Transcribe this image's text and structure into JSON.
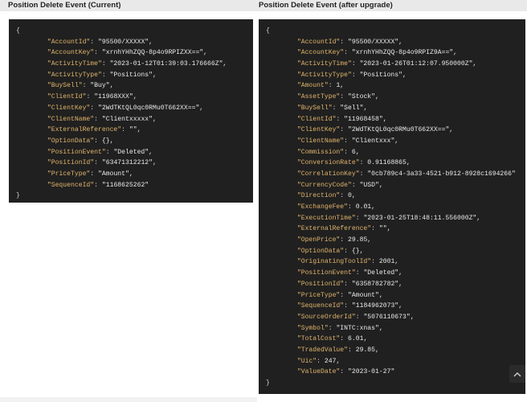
{
  "left": {
    "title": "Position Delete Event (Current)",
    "open_brace": "{",
    "close_brace": "}",
    "fields": [
      {
        "key": "\"AccountId\"",
        "value": "\"95500/XXXXX\","
      },
      {
        "key": "\"AccountKey\"",
        "value": "\"xrnhYHhZQQ-8p4o9RPIZXX==\","
      },
      {
        "key": "\"ActivityTime\"",
        "value": "\"2023-01-12T01:39:03.176666Z\","
      },
      {
        "key": "\"ActivityType\"",
        "value": "\"Positions\","
      },
      {
        "key": "\"BuySell\"",
        "value": "\"Buy\","
      },
      {
        "key": "\"ClientId\"",
        "value": "\"11968XXX\","
      },
      {
        "key": "\"ClientKey\"",
        "value": "\"2WdTKtQL0qc0RMu0T662XX==\","
      },
      {
        "key": "\"ClientName\"",
        "value": "\"Clientxxxxx\","
      },
      {
        "key": "\"ExternalReference\"",
        "value": "\"\","
      },
      {
        "key": "\"OptionData\"",
        "value": "{},"
      },
      {
        "key": "\"PositionEvent\"",
        "value": "\"Deleted\","
      },
      {
        "key": "\"PositionId\"",
        "value": "\"63471312212\","
      },
      {
        "key": "\"PriceType\"",
        "value": "\"Amount\","
      },
      {
        "key": "\"SequenceId\"",
        "value": "\"1168625262\""
      }
    ]
  },
  "right": {
    "title": "Position Delete Event (after upgrade)",
    "open_brace": "{",
    "close_brace": "}",
    "fields": [
      {
        "key": "\"AccountId\"",
        "value": "\"95500/XXXXX\","
      },
      {
        "key": "\"AccountKey\"",
        "value": "\"xrnhYHhZQQ-8p4o9RPIZ9A==\","
      },
      {
        "key": "\"ActivityTime\"",
        "value": "\"2023-01-26T01:12:07.950000Z\","
      },
      {
        "key": "\"ActivityType\"",
        "value": "\"Positions\","
      },
      {
        "key": "\"Amount\"",
        "value": "1,"
      },
      {
        "key": "\"AssetType\"",
        "value": "\"Stock\","
      },
      {
        "key": "\"BuySell\"",
        "value": "\"Sell\","
      },
      {
        "key": "\"ClientId\"",
        "value": "\"11968458\","
      },
      {
        "key": "\"ClientKey\"",
        "value": "\"2WdTKtQL0qc0RMu0T662XX==\","
      },
      {
        "key": "\"ClientName\"",
        "value": "\"Clientxxx\","
      },
      {
        "key": "\"Commission\"",
        "value": "6,"
      },
      {
        "key": "\"ConversionRate\"",
        "value": "0.91168865,"
      },
      {
        "key": "\"CorrelationKey\"",
        "value": "\"0cb789c4-3a33-4521-b912-8928c1694266\""
      },
      {
        "key": "\"CurrencyCode\"",
        "value": "\"USD\","
      },
      {
        "key": "\"Direction\"",
        "value": "0,"
      },
      {
        "key": "\"ExchangeFee\"",
        "value": "0.01,"
      },
      {
        "key": "\"ExecutionTime\"",
        "value": "\"2023-01-25T18:48:11.556000Z\","
      },
      {
        "key": "\"ExternalReference\"",
        "value": "\"\","
      },
      {
        "key": "\"OpenPrice\"",
        "value": "29.85,"
      },
      {
        "key": "\"OptionData\"",
        "value": "{},"
      },
      {
        "key": "\"OriginatingToolId\"",
        "value": "2001,"
      },
      {
        "key": "\"PositionEvent\"",
        "value": "\"Deleted\","
      },
      {
        "key": "\"PositionId\"",
        "value": "\"6358782782\","
      },
      {
        "key": "\"PriceType\"",
        "value": "\"Amount\","
      },
      {
        "key": "\"SequenceId\"",
        "value": "\"1184962073\","
      },
      {
        "key": "\"SourceOrderId\"",
        "value": "\"5076110673\","
      },
      {
        "key": "\"Symbol\"",
        "value": "\"INTC:xnas\","
      },
      {
        "key": "\"TotalCost\"",
        "value": "6.01,"
      },
      {
        "key": "\"TradedValue\"",
        "value": "29.85,"
      },
      {
        "key": "\"Uic\"",
        "value": "247,"
      },
      {
        "key": "\"ValueDate\"",
        "value": "\"2023-01-27\""
      }
    ]
  },
  "colors": {
    "code_background": "#202020",
    "key_color": "#e0b46b",
    "value_color": "#e8e8e8",
    "header_background": "#e9e9e9"
  },
  "icons": {
    "scroll_to_top": "chevron-up-icon"
  }
}
